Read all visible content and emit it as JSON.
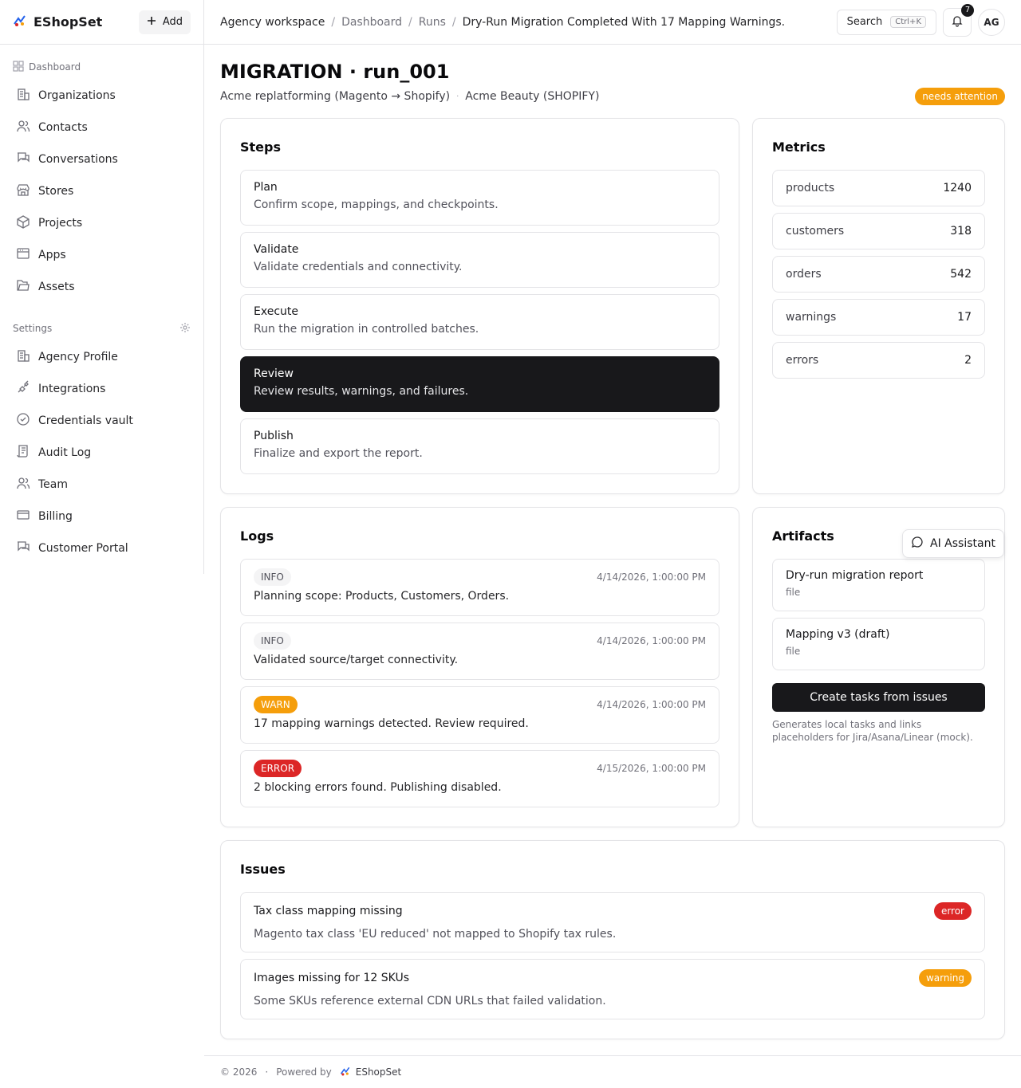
{
  "app": {
    "name": "EShopSet",
    "add_label": "Add"
  },
  "sidebar": {
    "section_main": "Dashboard",
    "items": [
      {
        "label": "Organizations",
        "icon": "building-icon"
      },
      {
        "label": "Contacts",
        "icon": "users-icon"
      },
      {
        "label": "Conversations",
        "icon": "chat-icon"
      },
      {
        "label": "Stores",
        "icon": "store-icon"
      },
      {
        "label": "Projects",
        "icon": "box-icon"
      },
      {
        "label": "Apps",
        "icon": "window-icon"
      },
      {
        "label": "Assets",
        "icon": "folder-icon"
      }
    ],
    "section_settings": "Settings",
    "settings_items": [
      {
        "label": "Agency Profile",
        "icon": "building-icon"
      },
      {
        "label": "Integrations",
        "icon": "plug-icon"
      },
      {
        "label": "Credentials vault",
        "icon": "check-circle-icon"
      },
      {
        "label": "Audit Log",
        "icon": "scroll-icon"
      },
      {
        "label": "Team",
        "icon": "users-icon"
      },
      {
        "label": "Billing",
        "icon": "card-icon"
      },
      {
        "label": "Customer Portal",
        "icon": "chat-icon"
      }
    ]
  },
  "topbar": {
    "breadcrumbs": [
      "Agency workspace",
      "Dashboard",
      "Runs",
      "Dry-Run Migration Completed With 17 Mapping Warnings."
    ],
    "search_label": "Search",
    "search_shortcut": "Ctrl+K",
    "notification_count": "7",
    "avatar_initials": "AG"
  },
  "page": {
    "title": "MIGRATION · run_001",
    "project": "Acme replatforming (Magento → Shopify)",
    "store": "Acme Beauty (SHOPIFY)",
    "status": "needs attention"
  },
  "steps": {
    "title": "Steps",
    "items": [
      {
        "name": "Plan",
        "desc": "Confirm scope, mappings, and checkpoints."
      },
      {
        "name": "Validate",
        "desc": "Validate credentials and connectivity."
      },
      {
        "name": "Execute",
        "desc": "Run the migration in controlled batches."
      },
      {
        "name": "Review",
        "desc": "Review results, warnings, and failures."
      },
      {
        "name": "Publish",
        "desc": "Finalize and export the report."
      }
    ],
    "active_index": 3
  },
  "metrics": {
    "title": "Metrics",
    "items": [
      {
        "key": "products",
        "value": "1240"
      },
      {
        "key": "customers",
        "value": "318"
      },
      {
        "key": "orders",
        "value": "542"
      },
      {
        "key": "warnings",
        "value": "17"
      },
      {
        "key": "errors",
        "value": "2"
      }
    ]
  },
  "logs": {
    "title": "Logs",
    "items": [
      {
        "level": "INFO",
        "time": "4/14/2026, 1:00:00 PM",
        "message": "Planning scope: Products, Customers, Orders."
      },
      {
        "level": "INFO",
        "time": "4/14/2026, 1:00:00 PM",
        "message": "Validated source/target connectivity."
      },
      {
        "level": "WARN",
        "time": "4/14/2026, 1:00:00 PM",
        "message": "17 mapping warnings detected. Review required."
      },
      {
        "level": "ERROR",
        "time": "4/15/2026, 1:00:00 PM",
        "message": "2 blocking errors found. Publishing disabled."
      }
    ]
  },
  "artifacts": {
    "title": "Artifacts",
    "items": [
      {
        "name": "Dry-run migration report",
        "type": "file"
      },
      {
        "name": "Mapping v3 (draft)",
        "type": "file"
      }
    ],
    "create_button": "Create tasks from issues",
    "note": "Generates local tasks and links placeholders for Jira/Asana/Linear (mock)."
  },
  "issues": {
    "title": "Issues",
    "items": [
      {
        "name": "Tax class mapping missing",
        "severity": "error",
        "desc": "Magento tax class 'EU reduced' not mapped to Shopify tax rules."
      },
      {
        "name": "Images missing for 12 SKUs",
        "severity": "warning",
        "desc": "Some SKUs reference external CDN URLs that failed validation."
      }
    ]
  },
  "assistant": {
    "label": "AI Assistant"
  },
  "footer": {
    "copyright": "© 2026",
    "powered_by": "Powered by",
    "brand": "EShopSet"
  },
  "colors": {
    "accent": "#18181b",
    "warning": "#f59e0b",
    "error": "#dc2626"
  }
}
